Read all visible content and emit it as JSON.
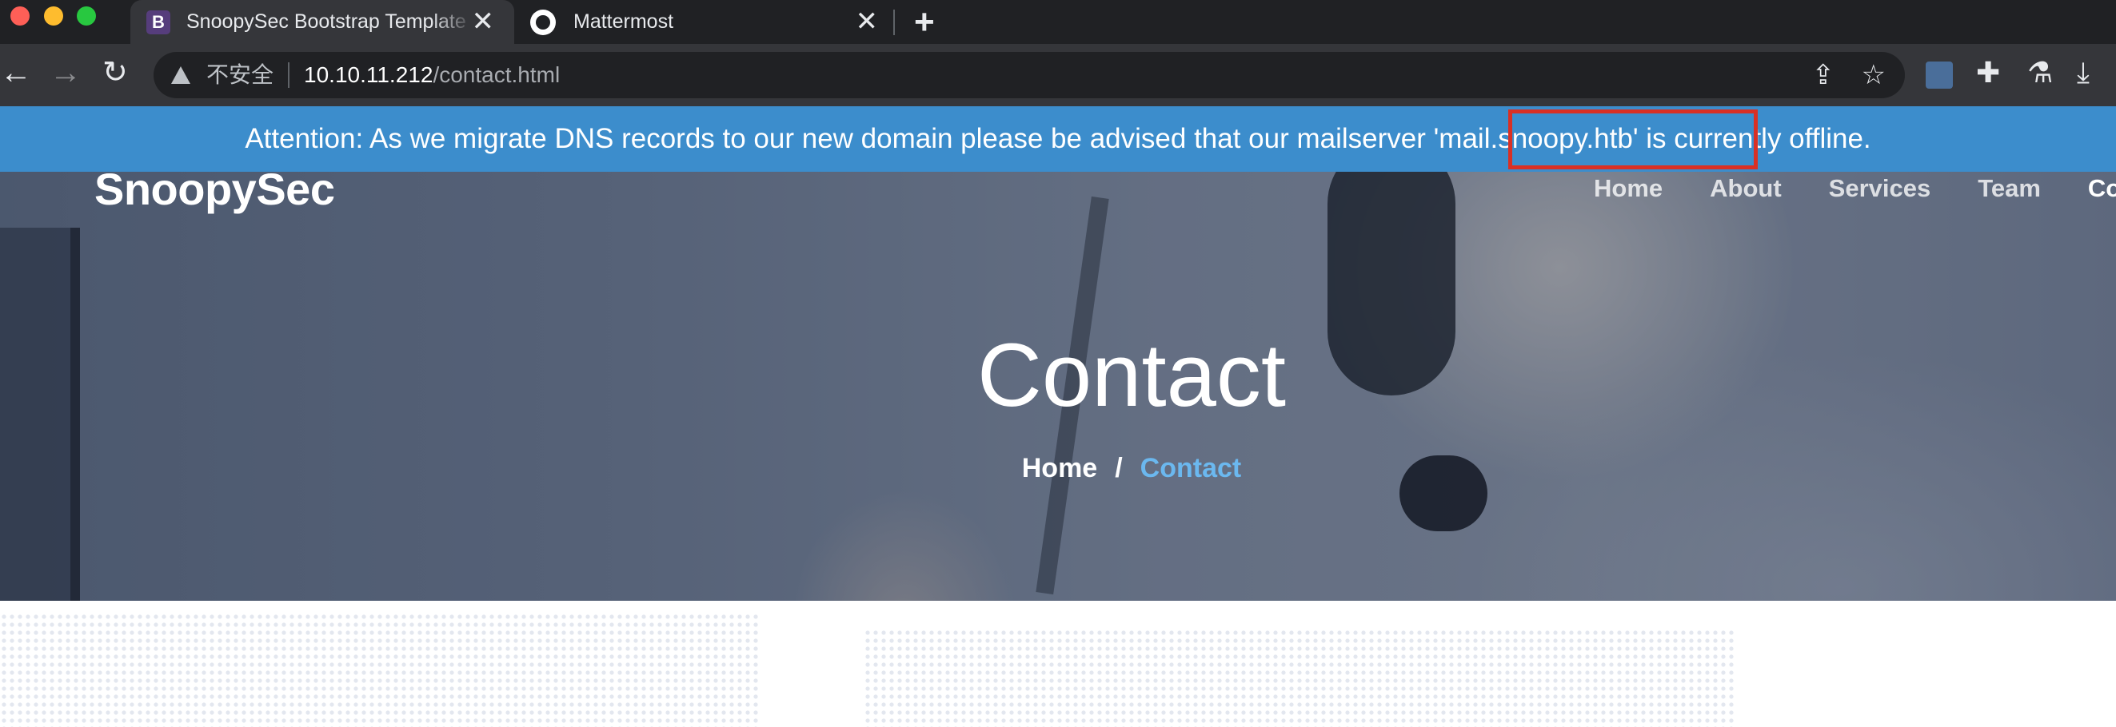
{
  "browser": {
    "tabs": [
      {
        "title": "SnoopySec Bootstrap Template",
        "favicon": "B",
        "active": true
      },
      {
        "title": "Mattermost",
        "favicon": "mattermost-icon",
        "active": false
      }
    ],
    "new_tab_icon": "+",
    "close_icon": "✕",
    "security_label": "不安全",
    "url_host": "10.10.11.212",
    "url_path": "/contact.html"
  },
  "page": {
    "alert_text": "Attention: As we migrate DNS records to our new domain please be advised that our mailserver 'mail.snoopy.htb' is currently offline.",
    "brand": "SnoopySec",
    "nav": [
      "Home",
      "About",
      "Services",
      "Team",
      "Contact"
    ],
    "hero_title": "Contact",
    "breadcrumb": {
      "home": "Home",
      "separator": "/",
      "current": "Contact"
    }
  },
  "colors": {
    "alert_bg": "#3c8dcc",
    "highlight_border": "#d93025",
    "breadcrumb_active": "#6bb8ef"
  }
}
